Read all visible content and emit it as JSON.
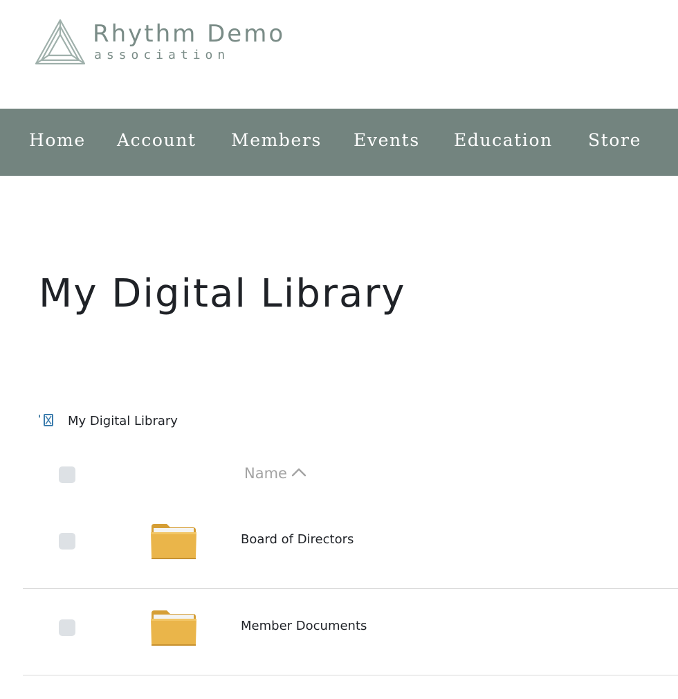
{
  "header": {
    "logo_title": "Rhythm Demo",
    "logo_subtitle": "association",
    "brand_color": "#73847f"
  },
  "nav": {
    "items": [
      {
        "label": "Home"
      },
      {
        "label": "Account"
      },
      {
        "label": "Members"
      },
      {
        "label": "Events"
      },
      {
        "label": "Education"
      },
      {
        "label": "Store"
      }
    ]
  },
  "page": {
    "title": "My Digital Library"
  },
  "breadcrumb": {
    "tick": "'",
    "icon": "broken-image-icon",
    "label": "My Digital Library"
  },
  "table": {
    "columns": [
      {
        "label": "Name",
        "sort": "ascending",
        "sort_icon": "chevron-up-icon"
      }
    ],
    "rows": [
      {
        "name": "Board of Directors",
        "icon": "folder-icon"
      },
      {
        "name": "Member Documents",
        "icon": "folder-icon"
      }
    ]
  }
}
